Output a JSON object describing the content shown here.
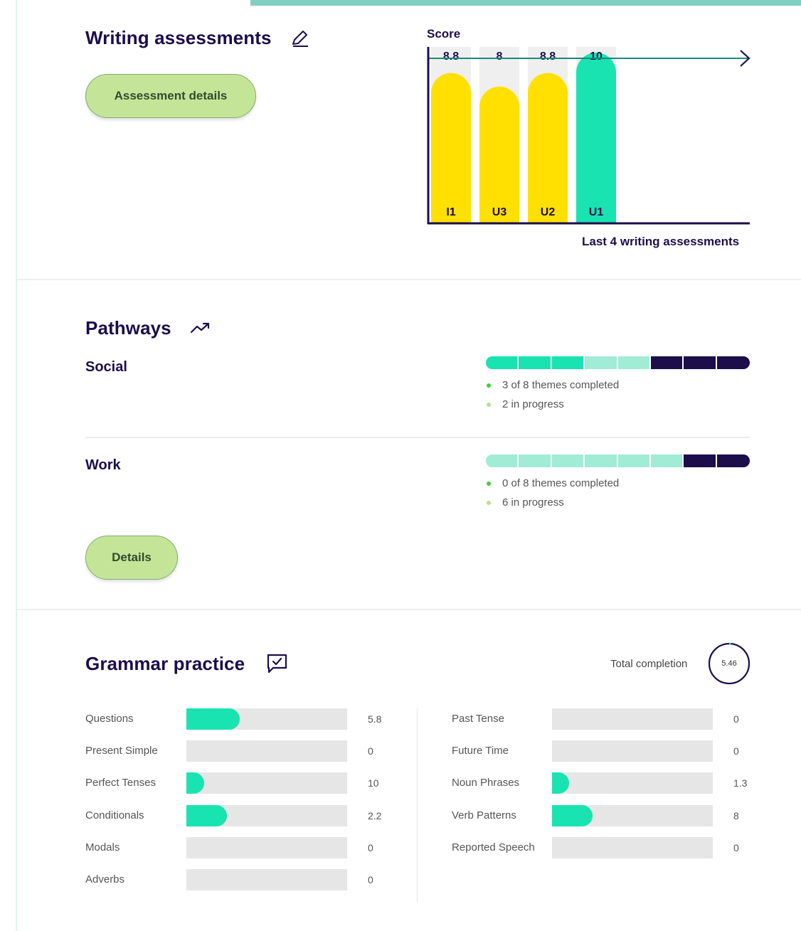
{
  "colors": {
    "yellow": "#ffe000",
    "teal": "#19e3b1",
    "teal_light": "#a0ecd5",
    "navy": "#1c0d4b",
    "button_green": "#c4e598"
  },
  "writing": {
    "title": "Writing assessments",
    "title_icon": "pencil-icon",
    "button_label": "Assessment details"
  },
  "chart_data": {
    "type": "bar",
    "ylabel": "Score",
    "caption": "Last 4 writing assessments",
    "categories": [
      "I1",
      "U3",
      "U2",
      "U1"
    ],
    "values": [
      8.8,
      8,
      8.8,
      10
    ],
    "value_labels": [
      "8.8",
      "8",
      "8.8",
      "10"
    ],
    "bar_colors": [
      "#ffe000",
      "#ffe000",
      "#ffe000",
      "#19e3b1"
    ],
    "ylim": [
      0,
      10
    ],
    "target_line": 10,
    "grid": false
  },
  "pathways": {
    "title": "Pathways",
    "title_icon": "trending-up-icon",
    "items": [
      {
        "label": "Social",
        "completed": 3,
        "in_progress": 2,
        "total": 8,
        "completed_text": "3 of 8 themes completed",
        "progress_text": "2 in progress"
      },
      {
        "label": "Work",
        "completed": 0,
        "in_progress": 6,
        "total": 8,
        "completed_text": "0 of 8 themes completed",
        "progress_text": "6 in progress"
      }
    ],
    "button_label": "Details"
  },
  "grammar": {
    "title": "Grammar practice",
    "title_icon": "chat-check-icon",
    "total_label": "Total completion",
    "total_value": "5.46",
    "total_fraction": 0.0546,
    "left": [
      {
        "label": "Questions",
        "value": "5.8",
        "fill": 0.33
      },
      {
        "label": "Present Simple",
        "value": "0",
        "fill": 0
      },
      {
        "label": "Perfect Tenses",
        "value": "10",
        "fill": 0.11
      },
      {
        "label": "Conditionals",
        "value": "2.2",
        "fill": 0.25
      },
      {
        "label": "Modals",
        "value": "0",
        "fill": 0
      },
      {
        "label": "Adverbs",
        "value": "0",
        "fill": 0
      }
    ],
    "right": [
      {
        "label": "Past Tense",
        "value": "0",
        "fill": 0
      },
      {
        "label": "Future Time",
        "value": "0",
        "fill": 0
      },
      {
        "label": "Noun Phrases",
        "value": "1.3",
        "fill": 0.09
      },
      {
        "label": "Verb Patterns",
        "value": "8",
        "fill": 0.25
      },
      {
        "label": "Reported Speech",
        "value": "0",
        "fill": 0
      }
    ]
  }
}
